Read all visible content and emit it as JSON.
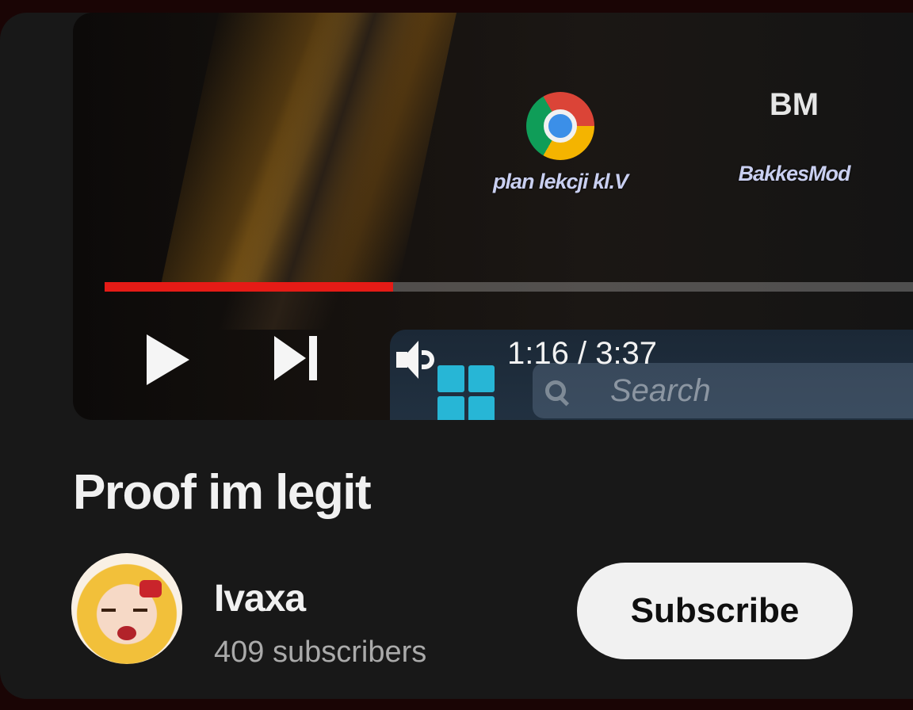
{
  "player": {
    "desktop_icons": [
      {
        "label": "plan lekcji kl.V",
        "icon": "chrome-icon"
      },
      {
        "label": "BakkesMod",
        "icon": "bakkesmod-icon"
      }
    ],
    "bm_logo_text": "BM",
    "progress_fraction": 0.35,
    "time": "1:16 / 3:37",
    "taskbar_search": "Search",
    "controls": [
      "play-icon",
      "next-icon",
      "volume-icon"
    ],
    "progress_color": "#e51b16"
  },
  "video": {
    "title": "Proof im legit"
  },
  "channel": {
    "name": "Ivaxa",
    "subscribers": "409 subscribers",
    "subscribe_label": "Subscribe"
  }
}
